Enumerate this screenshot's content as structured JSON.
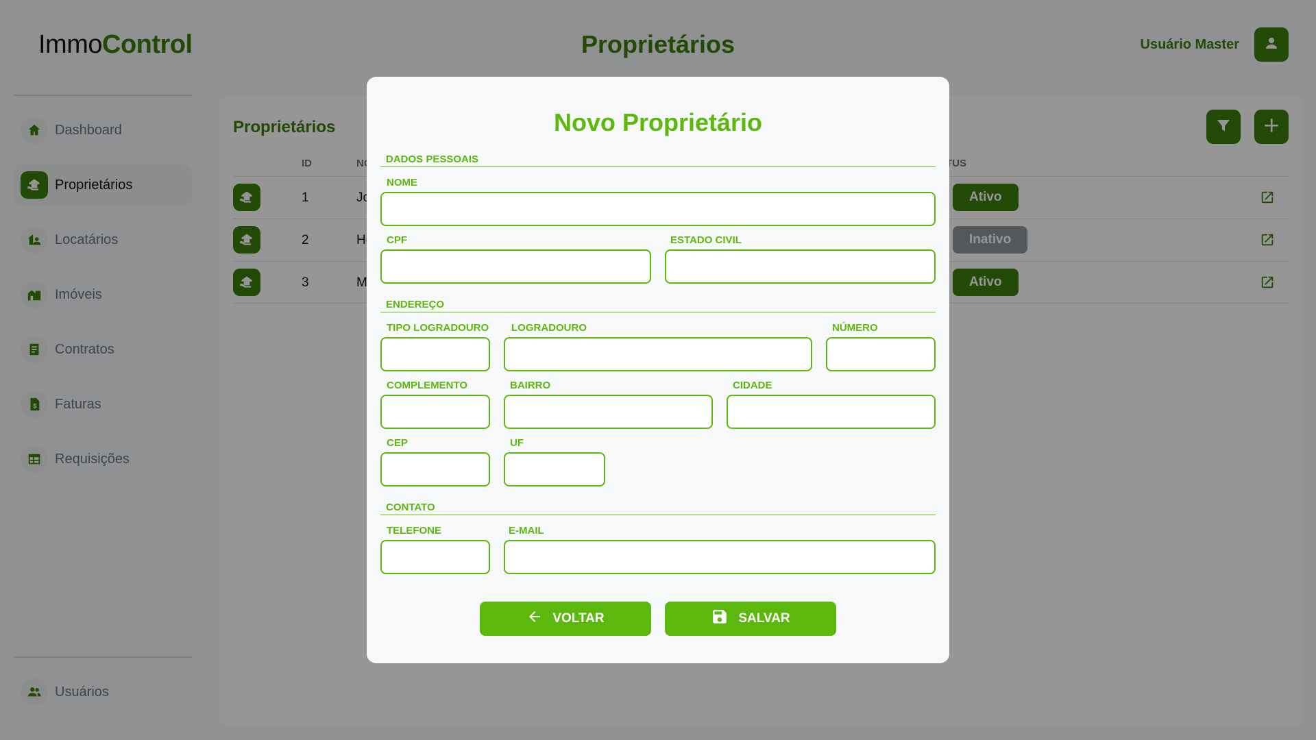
{
  "brand": {
    "part1": "Immo",
    "part2": "Control"
  },
  "header": {
    "title": "Proprietários",
    "user_name": "Usuário Master",
    "avatar_icon": "user-icon"
  },
  "sidebar": {
    "items": [
      {
        "label": "Dashboard",
        "icon": "home-icon",
        "active": false
      },
      {
        "label": "Proprietários",
        "icon": "owner-hand-house-icon",
        "active": true
      },
      {
        "label": "Locatários",
        "icon": "tenant-icon",
        "active": false
      },
      {
        "label": "Imóveis",
        "icon": "buildings-icon",
        "active": false
      },
      {
        "label": "Contratos",
        "icon": "contract-icon",
        "active": false
      },
      {
        "label": "Faturas",
        "icon": "invoice-icon",
        "active": false
      },
      {
        "label": "Requisições",
        "icon": "table-icon",
        "active": false
      }
    ],
    "bottom": {
      "label": "Usuários",
      "icon": "users-icon"
    }
  },
  "list": {
    "title": "Proprietários",
    "columns": {
      "id": "ID",
      "name": "NO",
      "status": "TUS"
    },
    "rows": [
      {
        "id": "1",
        "name": "Jo",
        "status": "Ativo",
        "status_color": "#3a7d0a"
      },
      {
        "id": "2",
        "name": "He",
        "status": "Inativo",
        "status_color": "#8f959c"
      },
      {
        "id": "3",
        "name": "M",
        "status": "Ativo",
        "status_color": "#3a7d0a"
      }
    ]
  },
  "modal": {
    "title": "Novo Proprietário",
    "sections": {
      "personal": "DADOS PESSOAIS",
      "address": "ENDEREÇO",
      "contact": "CONTATO"
    },
    "fields": {
      "nome": {
        "label": "NOME",
        "value": ""
      },
      "cpf": {
        "label": "CPF",
        "value": ""
      },
      "estado_civil": {
        "label": "ESTADO CIVIL",
        "value": ""
      },
      "tipo_logradouro": {
        "label": "TIPO LOGRADOURO",
        "value": ""
      },
      "logradouro": {
        "label": "LOGRADOURO",
        "value": ""
      },
      "numero": {
        "label": "NÚMERO",
        "value": ""
      },
      "complemento": {
        "label": "COMPLEMENTO",
        "value": ""
      },
      "bairro": {
        "label": "BAIRRO",
        "value": ""
      },
      "cidade": {
        "label": "CIDADE",
        "value": ""
      },
      "cep": {
        "label": "CEP",
        "value": ""
      },
      "uf": {
        "label": "UF",
        "value": ""
      },
      "telefone": {
        "label": "TELEFONE",
        "value": ""
      },
      "email": {
        "label": "E-MAIL",
        "value": ""
      }
    },
    "buttons": {
      "back": "VOLTAR",
      "save": "SALVAR"
    }
  },
  "colors": {
    "primary_dark": "#3a7d0a",
    "primary_light": "#5cb80c",
    "inactive": "#8f959c"
  }
}
